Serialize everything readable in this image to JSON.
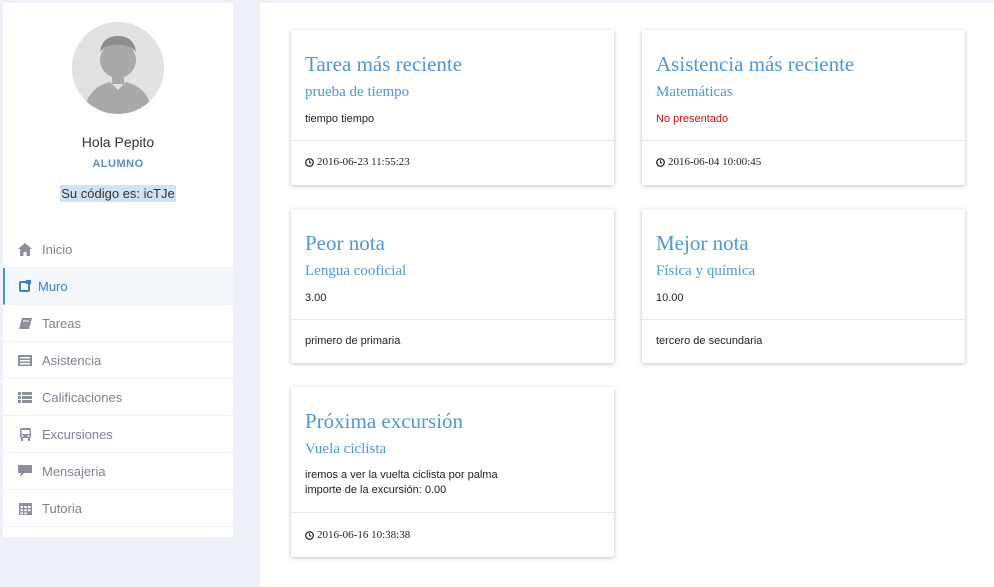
{
  "sidebar": {
    "greeting": "Hola Pepito",
    "role": "ALUMNO",
    "code": "Su código es: icTJe",
    "items": [
      {
        "label": "Inicio",
        "icon": "home-icon"
      },
      {
        "label": "Muro",
        "icon": "square-icon",
        "active": true
      },
      {
        "label": "Tareas",
        "icon": "book-icon"
      },
      {
        "label": "Asistencia",
        "icon": "list-alt-icon"
      },
      {
        "label": "Calificaciones",
        "icon": "list-icon"
      },
      {
        "label": "Excursiones",
        "icon": "bus-icon"
      },
      {
        "label": "Mensajeria",
        "icon": "comment-icon"
      },
      {
        "label": "Tutoria",
        "icon": "calendar-icon"
      }
    ]
  },
  "cards": {
    "task": {
      "title": "Tarea más reciente",
      "subtitle": "prueba de tiempo",
      "body": "tiempo tiempo",
      "footer": "2016-06-23 11:55:23"
    },
    "attendance": {
      "title": "Asistencia más reciente",
      "subtitle": "Matemáticas",
      "body": "No presentado",
      "footer": "2016-06-04 10:00:45"
    },
    "worst": {
      "title": "Peor nota",
      "subtitle": "Lengua cooficial",
      "body": "3.00",
      "footer": "primero de primaria"
    },
    "best": {
      "title": "Mejor nota",
      "subtitle": "Física y química",
      "body": "10.00",
      "footer": "tercero de secundaria"
    },
    "trip": {
      "title": "Próxima excursión",
      "subtitle": "Vuela ciclista",
      "body_line1": "iremos a ver la vuelta ciclista por palma",
      "body_line2": "importe de la excursión: 0.00",
      "footer": "2016-06-16 10:38:38"
    }
  },
  "colors": {
    "accent": "#4f97d6",
    "alert": "#d01010",
    "background": "#eef1f8"
  }
}
